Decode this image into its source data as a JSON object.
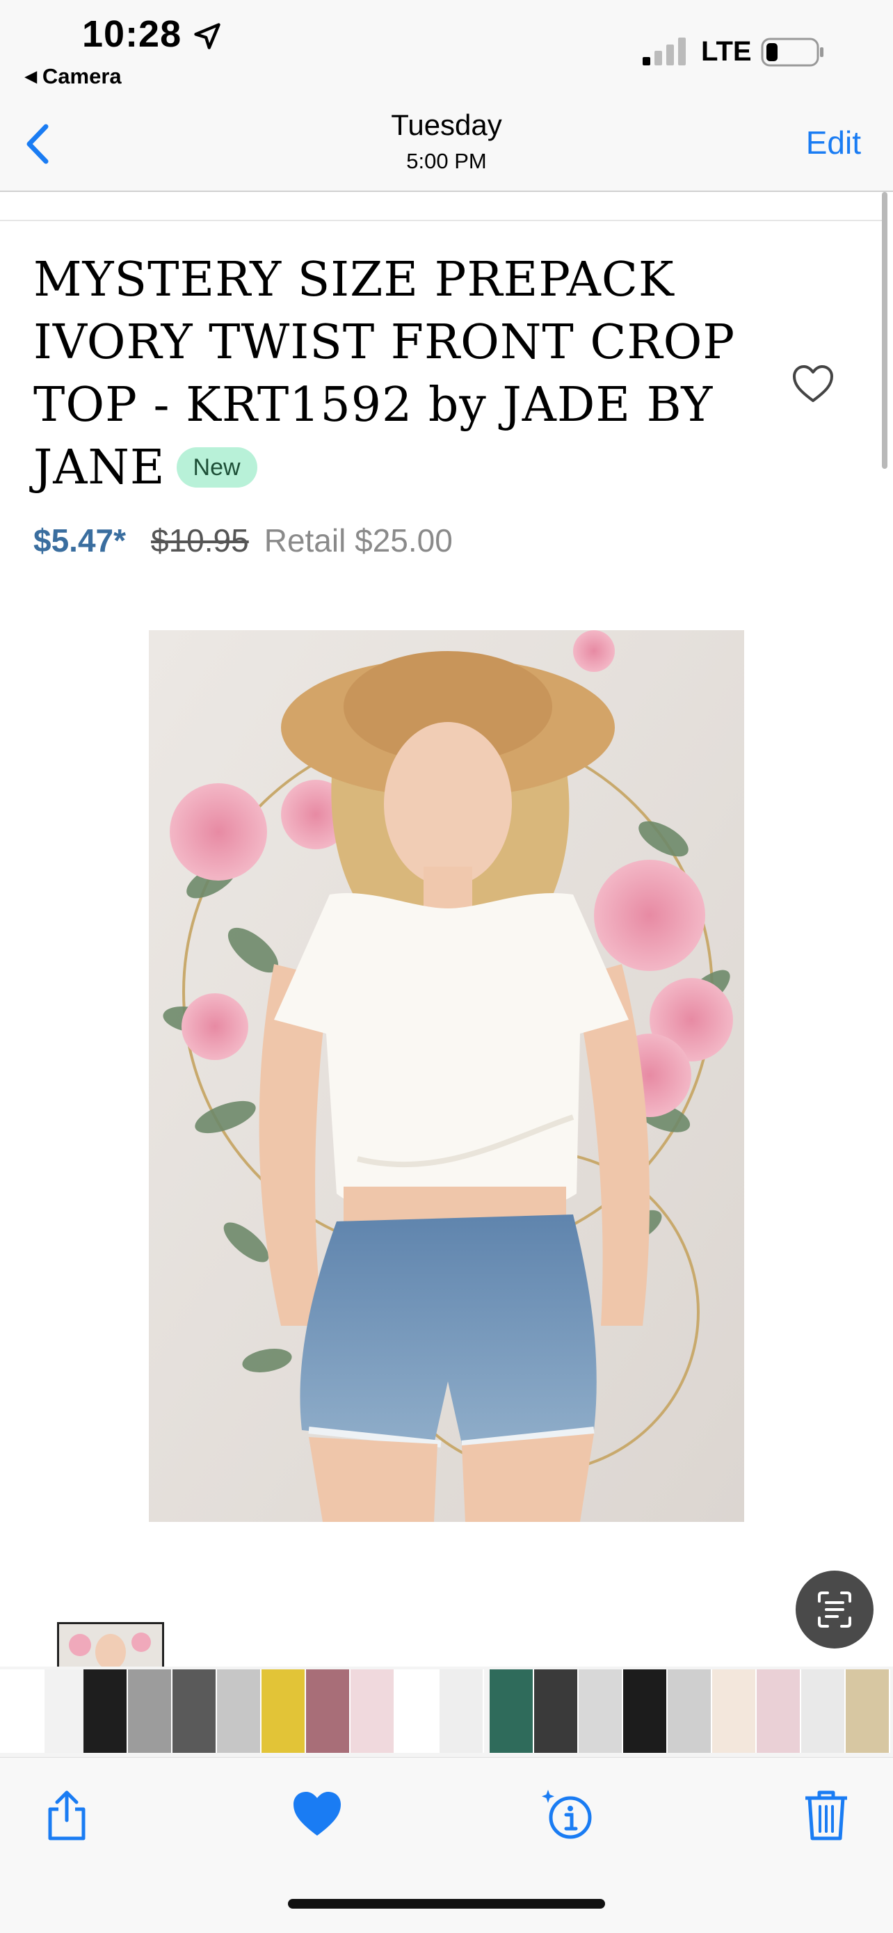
{
  "status_bar": {
    "time": "10:28",
    "back_app": "Camera",
    "carrier": "LTE",
    "icons": [
      "location-arrow-icon",
      "signal-bars-icon",
      "battery-icon"
    ]
  },
  "nav": {
    "title": "Tuesday",
    "subtitle": "5:00 PM",
    "edit_label": "Edit",
    "accent_color": "#1a7cf3"
  },
  "product": {
    "title": "MYSTERY SIZE PREPACK IVORY TWIST FRONT CROP TOP - KRT1592 by JADE BY JANE",
    "badge": "New",
    "price": "$5.47*",
    "original_price": "$10.95",
    "retail_price": "Retail $25.00",
    "photo": "model-in-ivory-crop-top-and-denim-shorts"
  },
  "toolbar": {
    "icons": [
      "share-icon",
      "favorite-heart-icon",
      "info-sparkle-icon",
      "trash-icon"
    ]
  }
}
